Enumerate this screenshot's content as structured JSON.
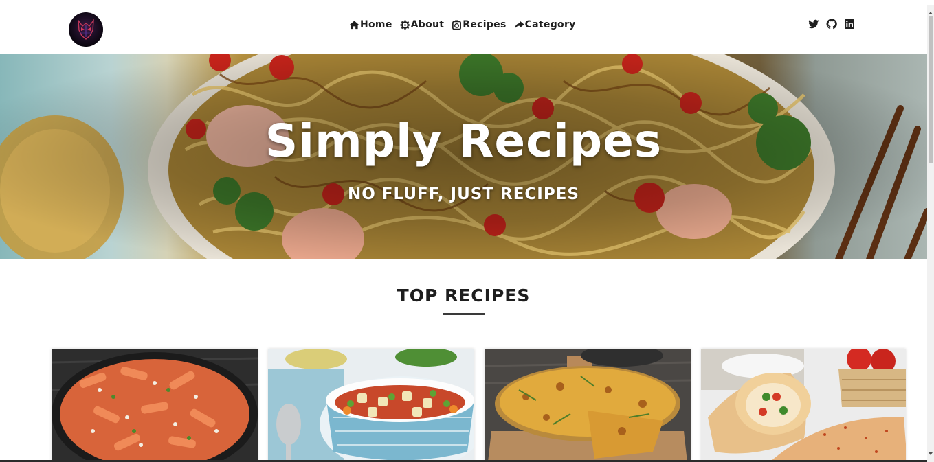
{
  "nav": {
    "logo_icon": "wolf-logo-icon",
    "links": [
      {
        "label": "Home",
        "icon": "home-icon"
      },
      {
        "label": "About",
        "icon": "gear-icon"
      },
      {
        "label": "Recipes",
        "icon": "timer-icon"
      },
      {
        "label": "Category",
        "icon": "share-arrow-icon"
      }
    ],
    "social": [
      {
        "icon": "twitter-icon"
      },
      {
        "icon": "github-icon"
      },
      {
        "icon": "linkedin-icon"
      }
    ]
  },
  "hero": {
    "title": "Simply Recipes",
    "subtitle": "NO FLUFF, JUST RECIPES"
  },
  "top_recipes": {
    "heading": "TOP RECIPES",
    "cards": [
      {
        "image": "penne-pasta-image"
      },
      {
        "image": "vegetable-soup-image"
      },
      {
        "image": "frittata-image"
      },
      {
        "image": "wrap-image"
      }
    ]
  },
  "colors": {
    "text": "#1f1f1f",
    "hero_text": "#ffffff",
    "underline": "#3a3a3a"
  }
}
